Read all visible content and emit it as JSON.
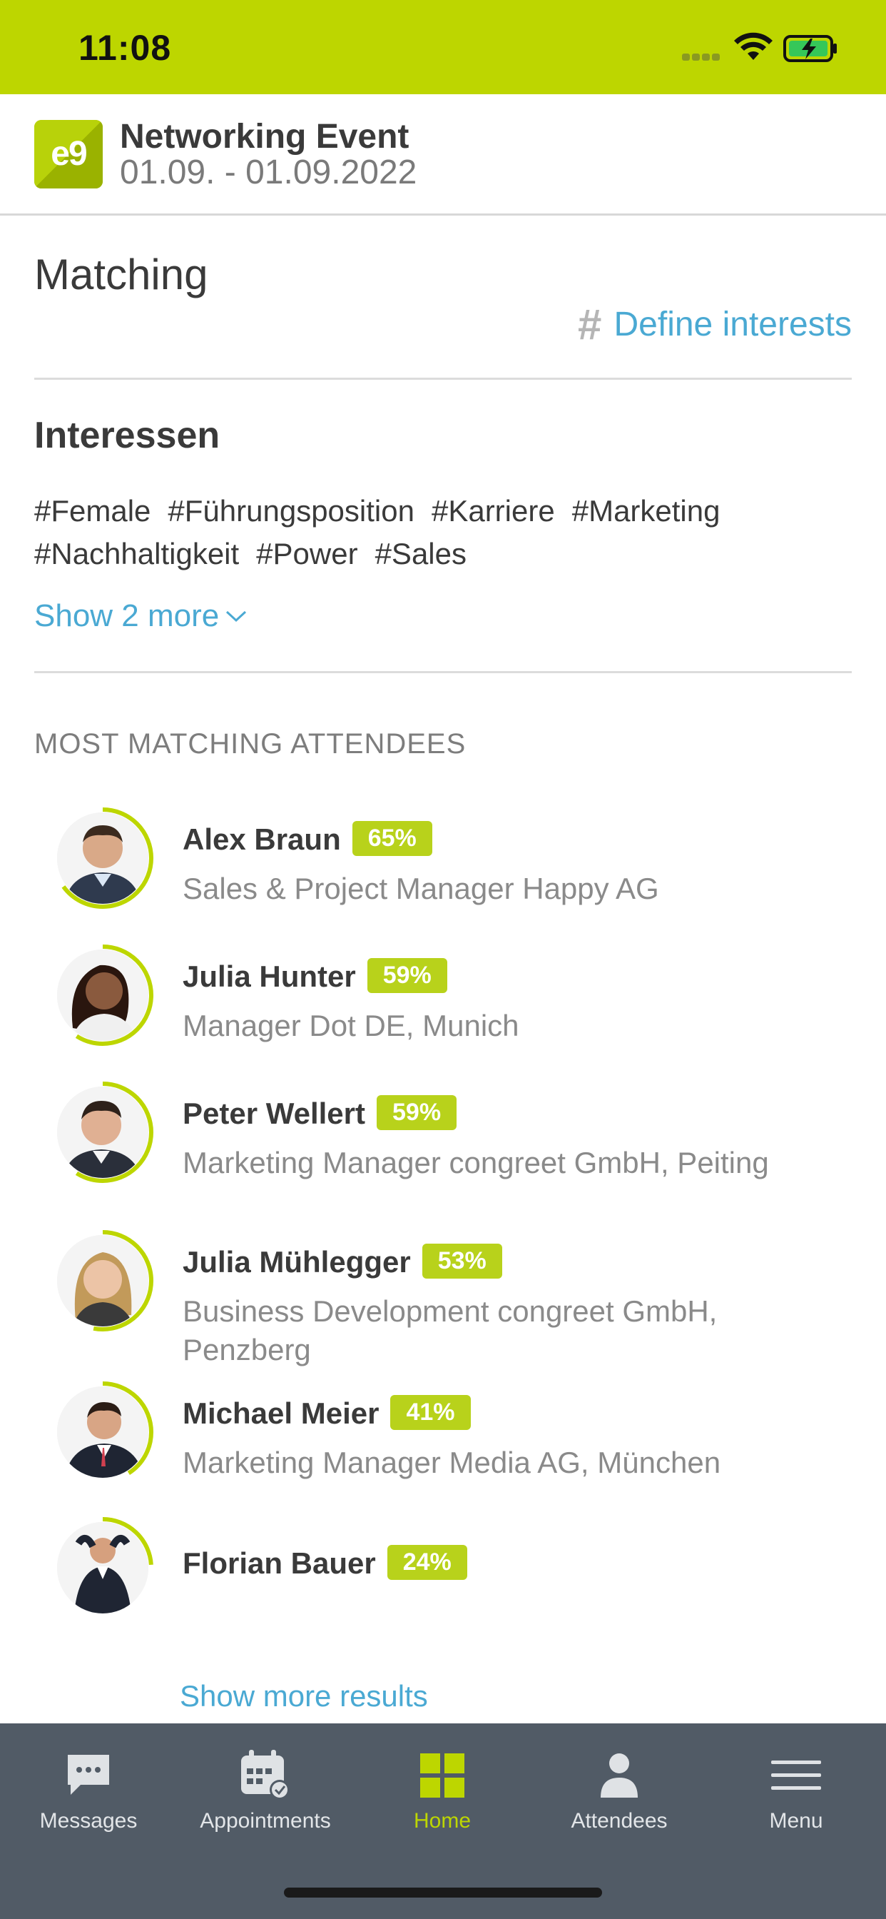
{
  "status_bar": {
    "time": "11:08",
    "accent": "#bdd600"
  },
  "header": {
    "logo_text": "e9",
    "title": "Networking Event",
    "dates": "01.09. - 01.09.2022"
  },
  "matching": {
    "title": "Matching",
    "define_link": "Define interests",
    "hash_symbol": "#"
  },
  "interests": {
    "title": "Interessen",
    "tags": [
      "#Female",
      "#Führungsposition",
      "#Karriere",
      "#Marketing",
      "#Nachhaltigkeit",
      "#Power",
      "#Sales"
    ],
    "show_more": "Show 2 more"
  },
  "attendees": {
    "heading": "MOST MATCHING ATTENDEES",
    "items": [
      {
        "name": "Alex Braun",
        "match": "65%",
        "match_fraction": 0.65,
        "role": "Sales & Project Manager Happy AG"
      },
      {
        "name": "Julia Hunter",
        "match": "59%",
        "match_fraction": 0.59,
        "role": "Manager Dot DE, Munich"
      },
      {
        "name": "Peter Wellert",
        "match": "59%",
        "match_fraction": 0.59,
        "role": "Marketing Manager congreet GmbH, Peiting"
      },
      {
        "name": "Julia Mühlegger",
        "match": "53%",
        "match_fraction": 0.53,
        "role": "Business Development congreet GmbH, Penzberg"
      },
      {
        "name": "Michael Meier",
        "match": "41%",
        "match_fraction": 0.41,
        "role": "Marketing Manager Media AG, München"
      },
      {
        "name": "Florian Bauer",
        "match": "24%",
        "match_fraction": 0.24,
        "role": ""
      }
    ],
    "more_results": "Show more results"
  },
  "tab_bar": {
    "tabs": [
      {
        "label": "Messages",
        "icon": "chat-bubble-icon"
      },
      {
        "label": "Appointments",
        "icon": "calendar-check-icon"
      },
      {
        "label": "Home",
        "icon": "grid-icon",
        "active": true
      },
      {
        "label": "Attendees",
        "icon": "person-icon"
      },
      {
        "label": "Menu",
        "icon": "hamburger-icon"
      }
    ]
  },
  "colors": {
    "accent_green": "#bdd600",
    "link_blue": "#4aa9d3",
    "tabbar": "#515b66"
  }
}
